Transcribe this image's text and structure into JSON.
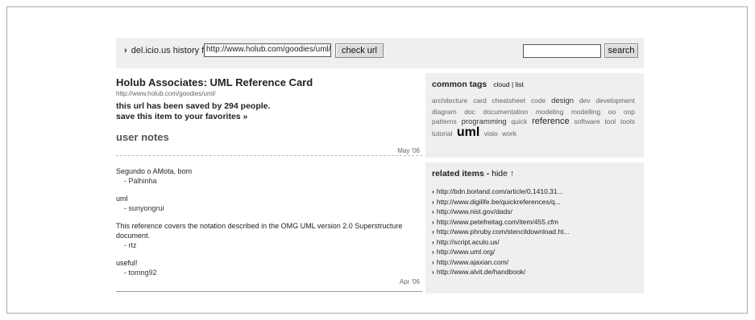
{
  "header": {
    "history_label": "del.icio.us history for",
    "url_value": "http://www.holub.com/goodies/uml/",
    "check_button": "check url",
    "search_value": "",
    "search_button": "search"
  },
  "page": {
    "title": "Holub Associates: UML Reference Card",
    "url": "http://www.holub.com/goodies/uml/",
    "saved_text": "this url has been saved by 294 people.",
    "favorites_link": "save this item to your favorites »",
    "user_notes_heading": "user notes",
    "first_date": "May '06",
    "last_date": "Apr '06"
  },
  "notes": [
    {
      "text": "Segundo o AMota, bom",
      "by": "- Palhinha"
    },
    {
      "text": "uml",
      "by": "- sunyongrui"
    },
    {
      "text": "This reference covers the notation described in the OMG UML version 2.0 Superstructure document.",
      "by": "- rtz"
    },
    {
      "text": "useful!",
      "by": "- tomng92"
    }
  ],
  "tags": {
    "heading": "common tags",
    "view_links": "cloud | list",
    "items": [
      {
        "label": "architecture",
        "size": 1
      },
      {
        "label": "card",
        "size": 1
      },
      {
        "label": "cheatsheet",
        "size": 1
      },
      {
        "label": "code",
        "size": 1
      },
      {
        "label": "design",
        "size": 2
      },
      {
        "label": "dev",
        "size": 1
      },
      {
        "label": "development",
        "size": 1
      },
      {
        "label": "diagram",
        "size": 1
      },
      {
        "label": "doc",
        "size": 1
      },
      {
        "label": "documentation",
        "size": 1
      },
      {
        "label": "modeling",
        "size": 1
      },
      {
        "label": "modelling",
        "size": 1
      },
      {
        "label": "oo",
        "size": 1
      },
      {
        "label": "oop",
        "size": 1
      },
      {
        "label": "patterns",
        "size": 1
      },
      {
        "label": "programming",
        "size": 2
      },
      {
        "label": "quick",
        "size": 1
      },
      {
        "label": "reference",
        "size": 3
      },
      {
        "label": "software",
        "size": 1
      },
      {
        "label": "tool",
        "size": 1
      },
      {
        "label": "tools",
        "size": 1
      },
      {
        "label": "tutorial",
        "size": 1
      },
      {
        "label": "uml",
        "size": 4
      },
      {
        "label": "visio",
        "size": 1
      },
      {
        "label": "work",
        "size": 1
      }
    ]
  },
  "related": {
    "heading": "related items -",
    "hide_label": "hide ↑",
    "items": [
      "http://bdn.borland.com/article/0,1410,31...",
      "http://www.digilife.be/quickreferences/q...",
      "http://www.nist.gov/dads/",
      "http://www.petefreitag.com/item/455.cfm",
      "http://www.phruby.com/stencildownload.ht...",
      "http://script.aculo.us/",
      "http://www.uml.org/",
      "http://www.ajaxian.com/",
      "http://www.alvit.de/handbook/"
    ]
  }
}
